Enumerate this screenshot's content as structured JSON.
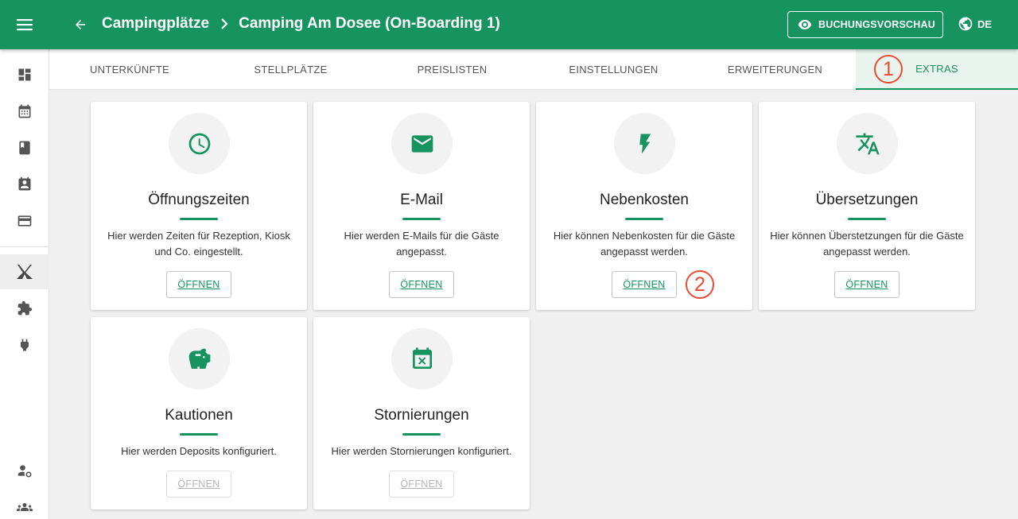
{
  "header": {
    "menu_icon": "menu-icon",
    "back_icon": "arrow-back-icon",
    "breadcrumb": [
      "Campingplätze",
      "Camping Am Dosee (On-Boarding 1)"
    ],
    "preview_label": "BUCHUNGSVORSCHAU",
    "preview_icon": "eye-icon",
    "language": "DE",
    "language_icon": "globe-icon",
    "color": "#17935f"
  },
  "sidebar": {
    "items": [
      {
        "icon": "dashboard-icon"
      },
      {
        "icon": "calendar-icon"
      },
      {
        "icon": "book-icon"
      },
      {
        "icon": "contact-calendar-icon"
      },
      {
        "icon": "credit-card-icon"
      },
      {
        "icon": "camping-tent-icon",
        "active": true
      },
      {
        "icon": "puzzle-icon"
      },
      {
        "icon": "plug-icon"
      },
      {
        "icon": "user-settings-icon"
      },
      {
        "icon": "group-icon"
      }
    ]
  },
  "tabs": [
    {
      "label": "UNTERKÜNFTE"
    },
    {
      "label": "STELLPLÄTZE"
    },
    {
      "label": "PREISLISTEN"
    },
    {
      "label": "EINSTELLUNGEN"
    },
    {
      "label": "ERWEITERUNGEN"
    },
    {
      "label": "EXTRAS",
      "active": true
    }
  ],
  "cards": [
    {
      "title": "Öffnungszeiten",
      "description": "Hier werden Zeiten für Rezeption, Kiosk und Co. eingestellt.",
      "button": "ÖFFNEN",
      "icon": "clock-icon",
      "disabled": false
    },
    {
      "title": "E-Mail",
      "description": "Hier werden E-Mails für die Gäste angepasst.",
      "button": "ÖFFNEN",
      "icon": "mail-icon",
      "disabled": false
    },
    {
      "title": "Nebenkosten",
      "description": "Hier können Nebenkosten für die Gäste angepasst werden.",
      "button": "ÖFFNEN",
      "icon": "lightning-icon",
      "disabled": false
    },
    {
      "title": "Übersetzungen",
      "description": "Hier können Überstetzungen für die Gäste angepasst werden.",
      "button": "ÖFFNEN",
      "icon": "translate-icon",
      "disabled": false
    },
    {
      "title": "Kautionen",
      "description": "Hier werden Deposits konfiguriert.",
      "button": "ÖFFNEN",
      "icon": "piggy-bank-icon",
      "disabled": true
    },
    {
      "title": "Stornierungen",
      "description": "Hier werden Stornierungen konfiguriert.",
      "button": "ÖFFNEN",
      "icon": "calendar-cancel-icon",
      "disabled": true
    }
  ],
  "annotations": [
    {
      "label": "1",
      "color": "#e84b32"
    },
    {
      "label": "2",
      "color": "#e84b32"
    }
  ]
}
